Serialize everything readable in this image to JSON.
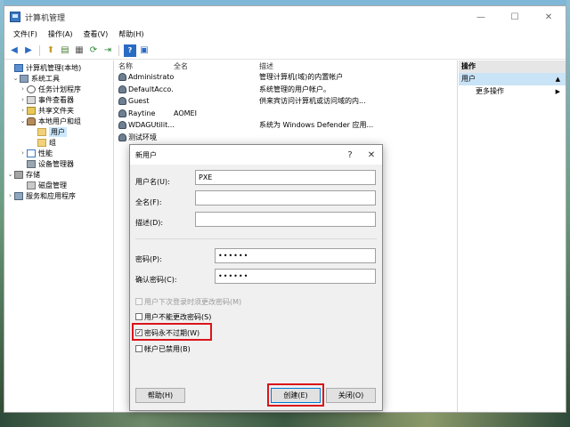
{
  "window": {
    "title": "计算机管理",
    "controls": {
      "minimize": "—",
      "maximize": "☐",
      "close": "✕"
    }
  },
  "menu": [
    "文件(F)",
    "操作(A)",
    "查看(V)",
    "帮助(H)"
  ],
  "toolbar": {
    "back": "◀",
    "forward": "▶",
    "up": "⬆",
    "show_hide": "▤",
    "properties": "▦",
    "refresh": "⟳",
    "export": "⇥",
    "help": "?",
    "console": "▣"
  },
  "tree": [
    {
      "label": "计算机管理(本地)",
      "expander": "",
      "icon": "pc-icon"
    },
    {
      "label": "系统工具",
      "expander": "⌄",
      "icon": "tool-icon"
    },
    {
      "label": "任务计划程序",
      "expander": "›",
      "icon": "clock-icon"
    },
    {
      "label": "事件查看器",
      "expander": "›",
      "icon": "log-icon"
    },
    {
      "label": "共享文件夹",
      "expander": "›",
      "icon": "share-icon"
    },
    {
      "label": "本地用户和组",
      "expander": "⌄",
      "icon": "users-icon"
    },
    {
      "label": "用户",
      "expander": "",
      "icon": "folder-icon"
    },
    {
      "label": "组",
      "expander": "",
      "icon": "folder-icon"
    },
    {
      "label": "性能",
      "expander": "›",
      "icon": "perf-icon"
    },
    {
      "label": "设备管理器",
      "expander": "",
      "icon": "device-icon"
    },
    {
      "label": "存储",
      "expander": "⌄",
      "icon": "storage-icon"
    },
    {
      "label": "磁盘管理",
      "expander": "",
      "icon": "disk-icon"
    },
    {
      "label": "服务和应用程序",
      "expander": "›",
      "icon": "service-icon"
    }
  ],
  "list": {
    "headers": {
      "name": "名称",
      "fullname": "全名",
      "description": "描述"
    },
    "rows": [
      {
        "name": "Administrator",
        "fullname": "",
        "description": "管理计算机(域)的内置帐户"
      },
      {
        "name": "DefaultAcco...",
        "fullname": "",
        "description": "系统管理的用户帐户。"
      },
      {
        "name": "Guest",
        "fullname": "",
        "description": "供来宾访问计算机或访问域的内..."
      },
      {
        "name": "Raytine",
        "fullname": "AOMEI",
        "description": ""
      },
      {
        "name": "WDAGUtilit...",
        "fullname": "",
        "description": "系统为 Windows Defender 应用..."
      },
      {
        "name": "测试环境",
        "fullname": "",
        "description": ""
      }
    ]
  },
  "actions": {
    "title": "操作",
    "section": "用户",
    "section_arrow": "▲",
    "item": "更多操作",
    "item_arrow": "▶"
  },
  "dialog": {
    "title": "新用户",
    "help": "?",
    "close": "✕",
    "username_label": "用户名(U):",
    "username_value": "PXE",
    "fullname_label": "全名(F):",
    "fullname_value": "",
    "description_label": "描述(D):",
    "description_value": "",
    "password_label": "密码(P):",
    "password_value": "••••••",
    "confirm_label": "确认密码(C):",
    "confirm_value": "••••••",
    "checkboxes": [
      {
        "label": "用户下次登录时须更改密码(M)",
        "checked": false,
        "disabled": true,
        "mark": ""
      },
      {
        "label": "用户不能更改密码(S)",
        "checked": false,
        "disabled": false,
        "mark": ""
      },
      {
        "label": "密码永不过期(W)",
        "checked": true,
        "disabled": false,
        "mark": "✓"
      },
      {
        "label": "帐户已禁用(B)",
        "checked": false,
        "disabled": false,
        "mark": ""
      }
    ],
    "buttons": {
      "help": "帮助(H)",
      "create": "创建(E)",
      "close": "关闭(O)"
    }
  },
  "colors": {
    "highlight": "#d9151a",
    "selection": "#cce8ff",
    "action_section": "#c9e3f7",
    "primary_border": "#0078d7"
  }
}
